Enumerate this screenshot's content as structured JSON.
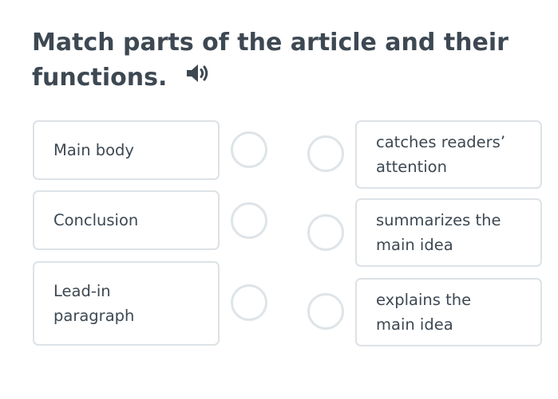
{
  "title": "Match parts of the article and their functions.",
  "icons": {
    "audio": "speaker-volume-icon"
  },
  "left_items": [
    {
      "label": "Main body"
    },
    {
      "label": "Conclusion"
    },
    {
      "label": "Lead-in paragraph"
    }
  ],
  "right_items": [
    {
      "label": "catches readers’ attention"
    },
    {
      "label": "summarizes the main idea"
    },
    {
      "label": "explains the main idea"
    }
  ],
  "colors": {
    "text": "#3d4852",
    "border": "#dde2e6",
    "radio_border": "#dfe4e8"
  }
}
